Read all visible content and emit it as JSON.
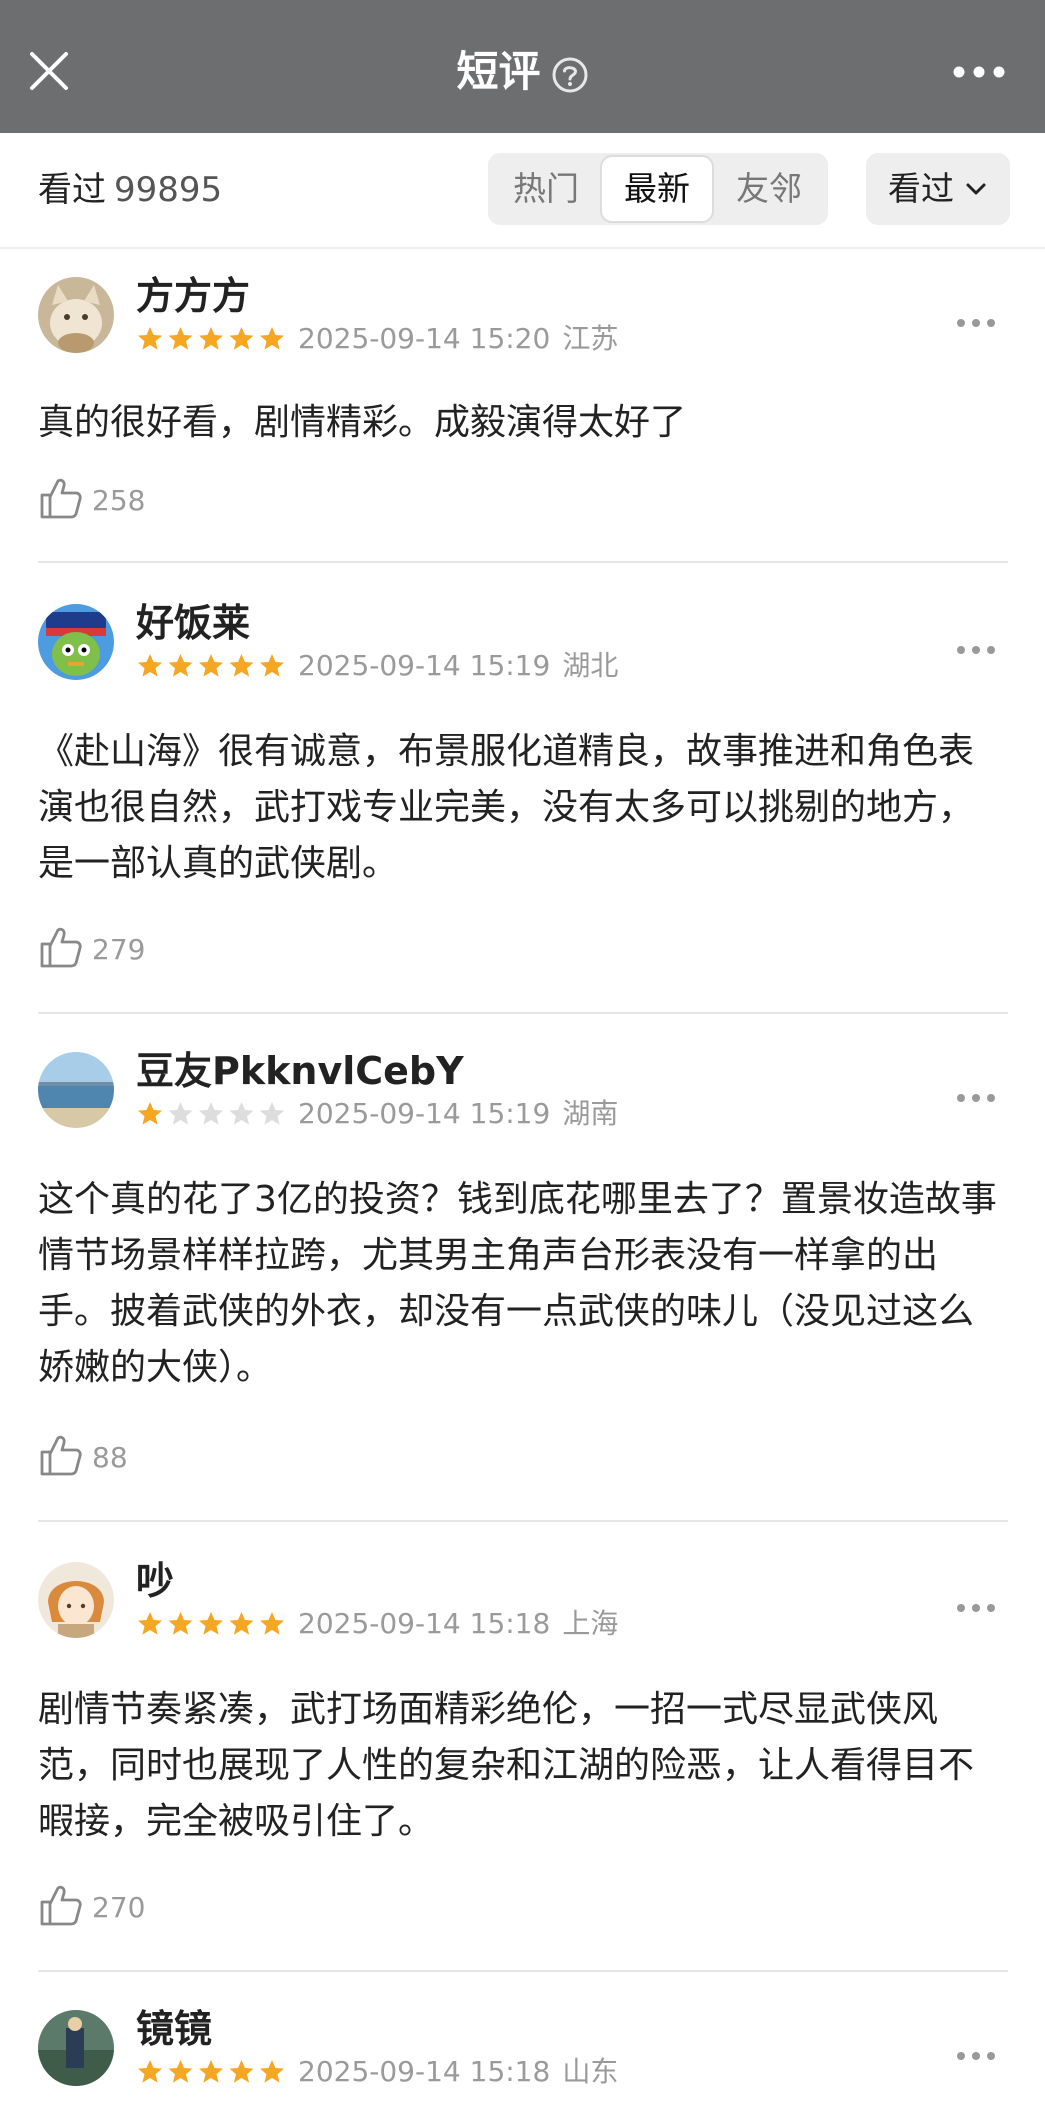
{
  "header": {
    "title": "短评"
  },
  "filter": {
    "seen_label": "看过",
    "seen_count": "99895",
    "tabs": [
      "热门",
      "最新",
      "友邻"
    ],
    "active_tab": "最新",
    "sort_label": "看过"
  },
  "colors": {
    "header_bg": "#6d6e70",
    "star": "#f5a623",
    "star_empty": "#dddddd"
  },
  "reviews": [
    {
      "user": "方方方",
      "rating": 5,
      "date": "2025-09-14 15:20",
      "location": "江苏",
      "content": "真的很好看，剧情精彩。成毅演得太好了",
      "likes": "258"
    },
    {
      "user": "好饭莱",
      "rating": 5,
      "date": "2025-09-14 15:19",
      "location": "湖北",
      "content": "《赴山海》很有诚意，布景服化道精良，故事推进和角色表演也很自然，武打戏专业完美，没有太多可以挑剔的地方，是一部认真的武侠剧。",
      "likes": "279"
    },
    {
      "user": "豆友PkknvlCebY",
      "rating": 1,
      "date": "2025-09-14 15:19",
      "location": "湖南",
      "content": "这个真的花了3亿的投资？钱到底花哪里去了？置景妆造故事情节场景样样拉跨，尤其男主角声台形表没有一样拿的出手。披着武侠的外衣，却没有一点武侠的味儿（没见过这么娇嫩的大侠）。",
      "likes": "88"
    },
    {
      "user": "吵",
      "rating": 5,
      "date": "2025-09-14 15:18",
      "location": "上海",
      "content": "剧情节奏紧凑，武打场面精彩绝伦，一招一式尽显武侠风范，同时也展现了人性的复杂和江湖的险恶，让人看得目不暇接，完全被吸引住了。",
      "likes": "270"
    },
    {
      "user": "镜镜",
      "rating": 5,
      "date": "2025-09-14 15:18",
      "location": "山东",
      "content": "",
      "likes": ""
    }
  ]
}
